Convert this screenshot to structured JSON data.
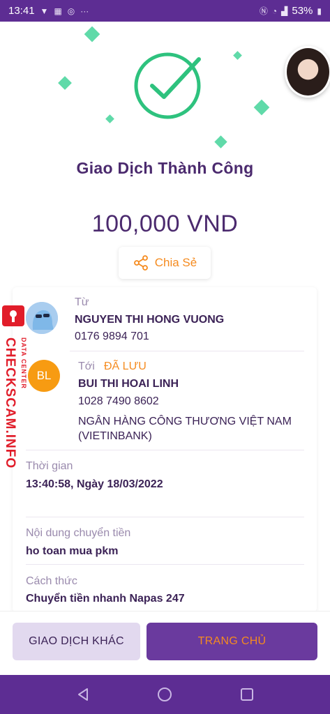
{
  "status_bar": {
    "time": "13:41",
    "icons_left": [
      "vpn-icon",
      "uniqlo-icon",
      "messenger-icon",
      "more-icon"
    ],
    "battery": "53%"
  },
  "result": {
    "title": "Giao Dịch Thành Công",
    "amount": "100,000 VND",
    "share_label": "Chia Sẻ",
    "accent_color": "#2ec27e"
  },
  "from": {
    "label": "Từ",
    "name": "NGUYEN THI HONG VUONG",
    "account": "0176 9894 701"
  },
  "to": {
    "label": "Tới",
    "saved_badge": "ĐÃ LƯU",
    "initials": "BL",
    "name": "BUI THI HOAI LINH",
    "account": "1028 7490 8602",
    "bank_line1": "NGÂN HÀNG CÔNG THƯƠNG VIỆT NAM",
    "bank_line2": "(VIETINBANK)"
  },
  "details": {
    "time_label": "Thời gian",
    "time_value": "13:40:58, Ngày 18/03/2022",
    "content_label": "Nội dung chuyển tiền",
    "content_value": "ho toan mua pkm",
    "method_label": "Cách thức",
    "method_value": "Chuyển tiền nhanh Napas 247"
  },
  "watermark": {
    "site": "CHECKSCAM.INFO",
    "sub": "DATA CENTER"
  },
  "actions": {
    "other_label": "GIAO DỊCH KHÁC",
    "home_label": "TRANG CHỦ"
  },
  "colors": {
    "brand_purple": "#5d2d93",
    "orange": "#f58b1f",
    "success_green": "#2ec27e"
  }
}
